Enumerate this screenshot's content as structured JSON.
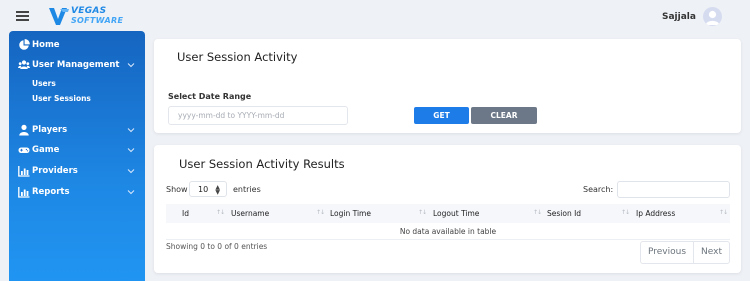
{
  "header": {
    "logo_line1": "VEGAS",
    "logo_line2": "SOFTWARE",
    "user_name": "Sajjala"
  },
  "sidebar": {
    "items": [
      {
        "label": "Home",
        "icon": "pie-chart-icon"
      },
      {
        "label": "User Management",
        "icon": "users-icon",
        "expanded": true
      },
      {
        "label": "Players",
        "icon": "user-icon"
      },
      {
        "label": "Game",
        "icon": "gamepad-icon"
      },
      {
        "label": "Providers",
        "icon": "bar-chart-icon"
      },
      {
        "label": "Reports",
        "icon": "bar-chart-icon"
      }
    ],
    "sub_items": [
      {
        "label": "Users"
      },
      {
        "label": "User Sessions",
        "active": true
      }
    ]
  },
  "filter": {
    "title": "User Session Activity",
    "date_label": "Select Date Range",
    "date_placeholder": "yyyy-mm-dd to YYYY-mm-dd",
    "get_label": "GET",
    "clear_label": "CLEAR"
  },
  "results": {
    "title": "User Session Activity Results",
    "show_label": "Show",
    "page_size": "10",
    "entries_label": "entries",
    "search_label": "Search:",
    "columns": [
      "Id",
      "Username",
      "Login Time",
      "Logout Time",
      "Sesion Id",
      "Ip Address"
    ],
    "empty_message": "No data available in table",
    "info": "Showing 0 to 0 of 0 entries",
    "prev_label": "Previous",
    "next_label": "Next"
  },
  "colors": {
    "sidebar_top": "#1565c0",
    "sidebar_bottom": "#2196f3",
    "primary_button": "#1e7ce8",
    "secondary_button": "#6c7887",
    "page_bg": "#eef1f6"
  }
}
